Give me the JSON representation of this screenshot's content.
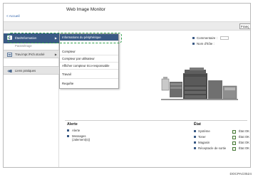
{
  "header": {
    "title": "Web Image Monitor",
    "back_link": "< Accueil",
    "language": "Franç"
  },
  "sidebar": {
    "items": [
      {
        "label": "État/Information",
        "icon": "info-icon",
        "has_submenu": true
      },
      {
        "label": "Paramétrage",
        "icon": "settings-icon"
      },
      {
        "label": "Trav.impr./Fich.stocké",
        "icon": "print-jobs-icon",
        "has_submenu": true
      },
      {
        "label": "Liens pratiques",
        "icon": "link-icon"
      }
    ]
  },
  "submenu": {
    "items": [
      {
        "label": "Informations du périphérique",
        "active": true
      },
      {
        "label": "Compteur"
      },
      {
        "label": "Compteur par utilisateur"
      },
      {
        "label": "Afficher compteur éco-responsable"
      },
      {
        "label": "Travail"
      },
      {
        "label": "Requête"
      }
    ]
  },
  "device_info": {
    "comment_label": "Commentaire :",
    "host_label": "Nom d'hôte :"
  },
  "alerts": {
    "title": "Alerte",
    "items": [
      {
        "label": "Alerte"
      },
      {
        "label_line1": "Messages",
        "label_line2": "(Jalement(s))"
      }
    ]
  },
  "status": {
    "title": "État",
    "rows": [
      {
        "name": "Système",
        "value": "État OK"
      },
      {
        "name": "Toner",
        "value": "État OK"
      },
      {
        "name": "Magasin",
        "value": "État OK"
      },
      {
        "name": "Réceptacle de sortie",
        "value": "État OK"
      }
    ]
  },
  "caption": "DOCPAC0524",
  "colors": {
    "accent": "#3a5a85",
    "callout": "#2e9e4a",
    "link": "#2a5ea8"
  }
}
